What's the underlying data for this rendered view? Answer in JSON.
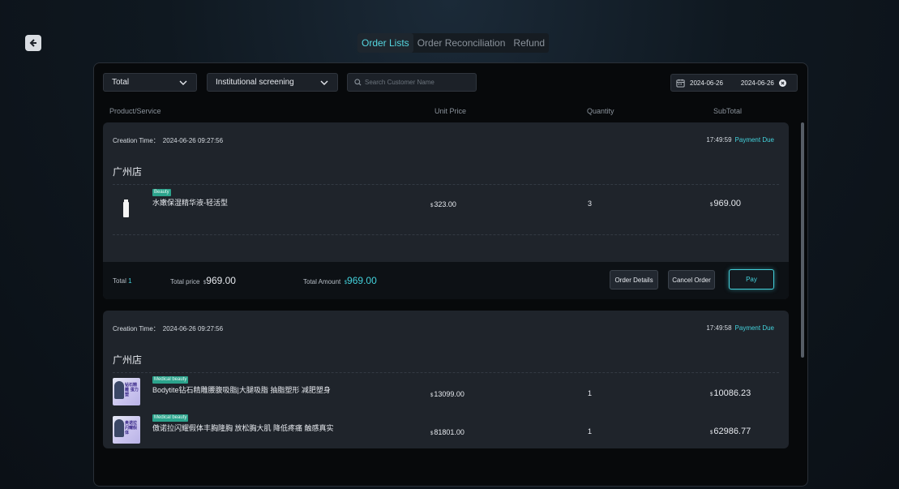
{
  "tabs": [
    {
      "label": "Order Lists"
    },
    {
      "label": "Order Reconciliation"
    },
    {
      "label": "Refund"
    }
  ],
  "filters": {
    "status_select": "Total",
    "institution_select": "Institutional screening",
    "search_placeholder": "Search Customer Name",
    "date_start": "2024-06-26",
    "date_end": "2024-06-26"
  },
  "columns": {
    "product": "Product/Service",
    "unit_price": "Unit Price",
    "quantity": "Quantity",
    "subtotal": "SubTotal"
  },
  "currency": "$",
  "orders": [
    {
      "creation_label": "Creation Time：",
      "creation_time": "2024-06-26 09:27:56",
      "countdown": "17:49:59",
      "status": "Payment Due",
      "store": "广州店",
      "items": [
        {
          "tag": "Beauty",
          "name": "水嫩保湿精华液-轻活型",
          "unit_price": "323.00",
          "qty": "3",
          "subtotal": "969.00"
        }
      ],
      "footer": {
        "total_label": "Total",
        "total_count": "1",
        "price_label": "Total price",
        "price": "969.00",
        "amount_label": "Total Amount",
        "amount": "969.00"
      },
      "buttons": {
        "details": "Order Details",
        "cancel": "Cancel Order",
        "pay": "Pay"
      }
    },
    {
      "creation_label": "Creation Time：",
      "creation_time": "2024-06-26 09:27:56",
      "countdown": "17:49:58",
      "status": "Payment Due",
      "store": "广州店",
      "items": [
        {
          "tag": "Medical beauty",
          "name": "Bodytite钻石精雕腰腹吸脂|大腿吸脂 抽脂塑形 减肥塑身",
          "unit_price": "13099.00",
          "qty": "1",
          "subtotal": "10086.23",
          "thumb_text": "钻石精雕 蛋力塑"
        },
        {
          "tag": "Medical beauty",
          "name": "傲诺拉闪耀假体丰胸隆胸 放松胸大肌 降低疼痛 触感真实",
          "unit_price": "81801.00",
          "qty": "1",
          "subtotal": "62986.77",
          "thumb_text": "奥诺拉 闪耀假体"
        }
      ]
    }
  ],
  "colors": {
    "accent": "#43d2dc",
    "tag": "#2ba38c"
  }
}
